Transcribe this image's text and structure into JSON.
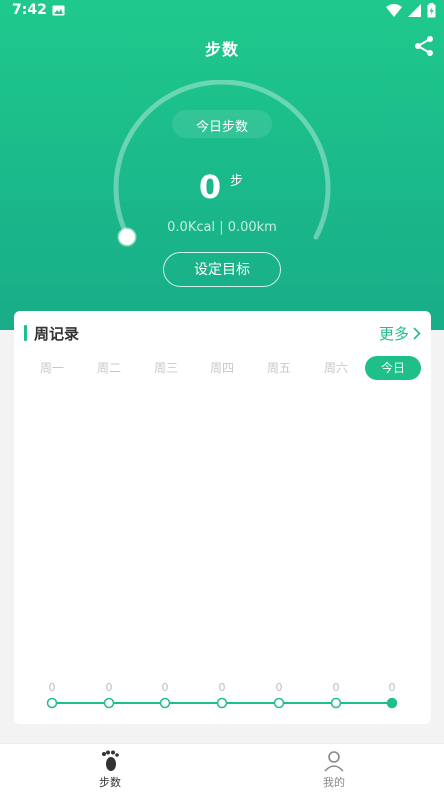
{
  "status_bar": {
    "time": "7:42"
  },
  "header": {
    "title": "步数"
  },
  "gauge": {
    "label": "今日步数",
    "steps": "0",
    "unit": "步",
    "summary": "0.0Kcal | 0.00km",
    "progress": 0
  },
  "goal_button": {
    "label": "设定目标"
  },
  "week": {
    "title": "周记录",
    "more": "更多",
    "days": [
      "周一",
      "周二",
      "周三",
      "周四",
      "周五",
      "周六",
      "今日"
    ],
    "values": [
      "0",
      "0",
      "0",
      "0",
      "0",
      "0",
      "0"
    ],
    "active_index": 6
  },
  "nav": {
    "steps_label": "步数",
    "mine_label": "我的"
  },
  "colors": {
    "accent": "#1fbf8a",
    "gradient_top": "#1fc98c",
    "gradient_bottom": "#18ad88"
  }
}
